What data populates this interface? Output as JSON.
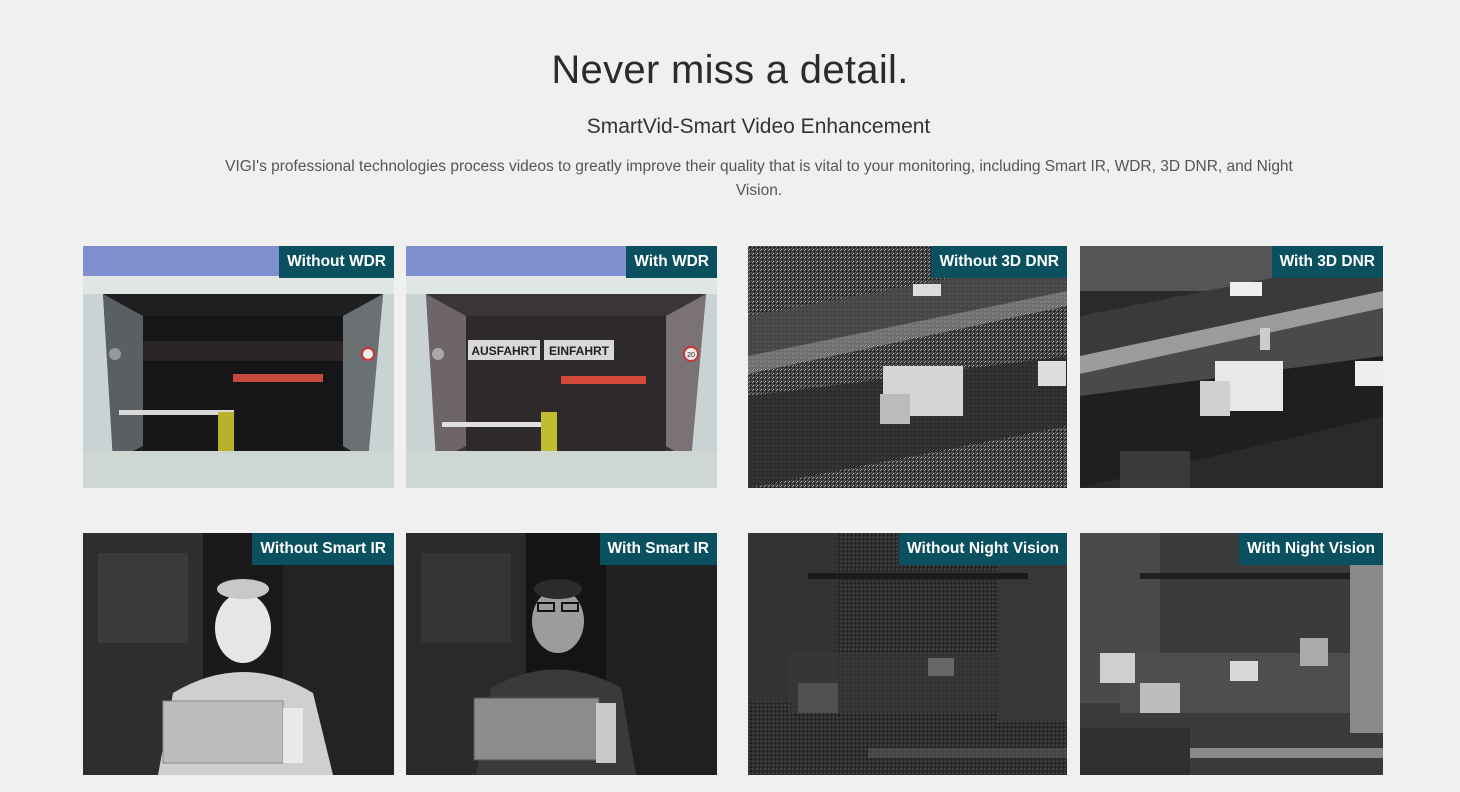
{
  "header": {
    "title": "Never miss a detail.",
    "subtitle": "SmartVid-Smart Video Enhancement",
    "description": "VIGI's professional technologies process videos to greatly improve their quality that is vital to your monitoring, including Smart IR, WDR, 3D DNR, and Night Vision."
  },
  "panels": {
    "without_wdr": "Without WDR",
    "with_wdr": "With WDR",
    "without_dnr": "Without 3D DNR",
    "with_dnr": "With 3D DNR",
    "without_ir": "Without Smart IR",
    "with_ir": "With Smart IR",
    "without_nv": "Without Night Vision",
    "with_nv": "With Night Vision"
  },
  "scene_text": {
    "garage_sign_left": "AUSFAHRT",
    "garage_sign_right": "EINFAHRT",
    "speed_limit": "20"
  },
  "colors": {
    "tag_background": "#0a505e",
    "page_background": "#f0f0f0"
  }
}
